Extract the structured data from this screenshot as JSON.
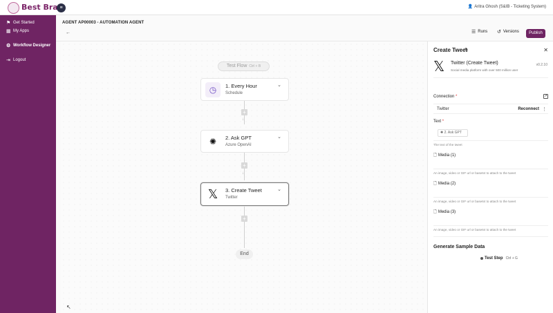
{
  "header": {
    "brand": "Best Brain",
    "menu_icon": "menu-icon",
    "user": "Aritra Ghosh (S&IB - Ticketing System)"
  },
  "sidebar": {
    "items": [
      {
        "label": "Get Started",
        "icon": "rocket-icon"
      },
      {
        "label": "My Apps",
        "icon": "grid-icon"
      },
      {
        "label": "Workflow Designer",
        "icon": "workflow-icon"
      },
      {
        "label": "Logout",
        "icon": "logout-icon"
      }
    ]
  },
  "main": {
    "agent_title": "AGENT AP00003 - AUTOMATION AGENT",
    "back_label": "←",
    "runs_label": "Runs",
    "versions_label": "Versions",
    "publish_label": "Publish"
  },
  "canvas": {
    "test_flow": "Test Flow",
    "test_flow_shortcut": "Ctrl + B",
    "steps": [
      {
        "title": "1. Every Hour",
        "subtitle": "Schedule",
        "icon": "clock-icon"
      },
      {
        "title": "2. Ask GPT",
        "subtitle": "Azure OpenAI",
        "icon": "openai-icon"
      },
      {
        "title": "3. Create Tweet",
        "subtitle": "Twitter",
        "icon": "x-logo-icon"
      }
    ],
    "end_label": "End"
  },
  "panel": {
    "title": "Create Tweet",
    "app_name": "Twitter (Create Tweet)",
    "app_desc": "Social media platform with over 500 million user",
    "version": "v0.2.10",
    "connection_label": "Connection",
    "connection_value": "Twitter",
    "reconnect_label": "Reconnect",
    "text_label": "Text",
    "text_chip": "2. Ask GPT",
    "text_help": "The text of the tweet",
    "media": [
      {
        "label": "Media (1)",
        "help": "An image, video or GIF url or base64 to attach to the tweet"
      },
      {
        "label": "Media (2)",
        "help": "An image, video or GIF url or base64 to attach to the tweet"
      },
      {
        "label": "Media (3)",
        "help": "An image, video or GIF url or base64 to attach to the tweet"
      }
    ],
    "sample_heading": "Generate Sample Data",
    "test_step_label": "Test Step",
    "test_step_shortcut": "Ctrl + G"
  }
}
